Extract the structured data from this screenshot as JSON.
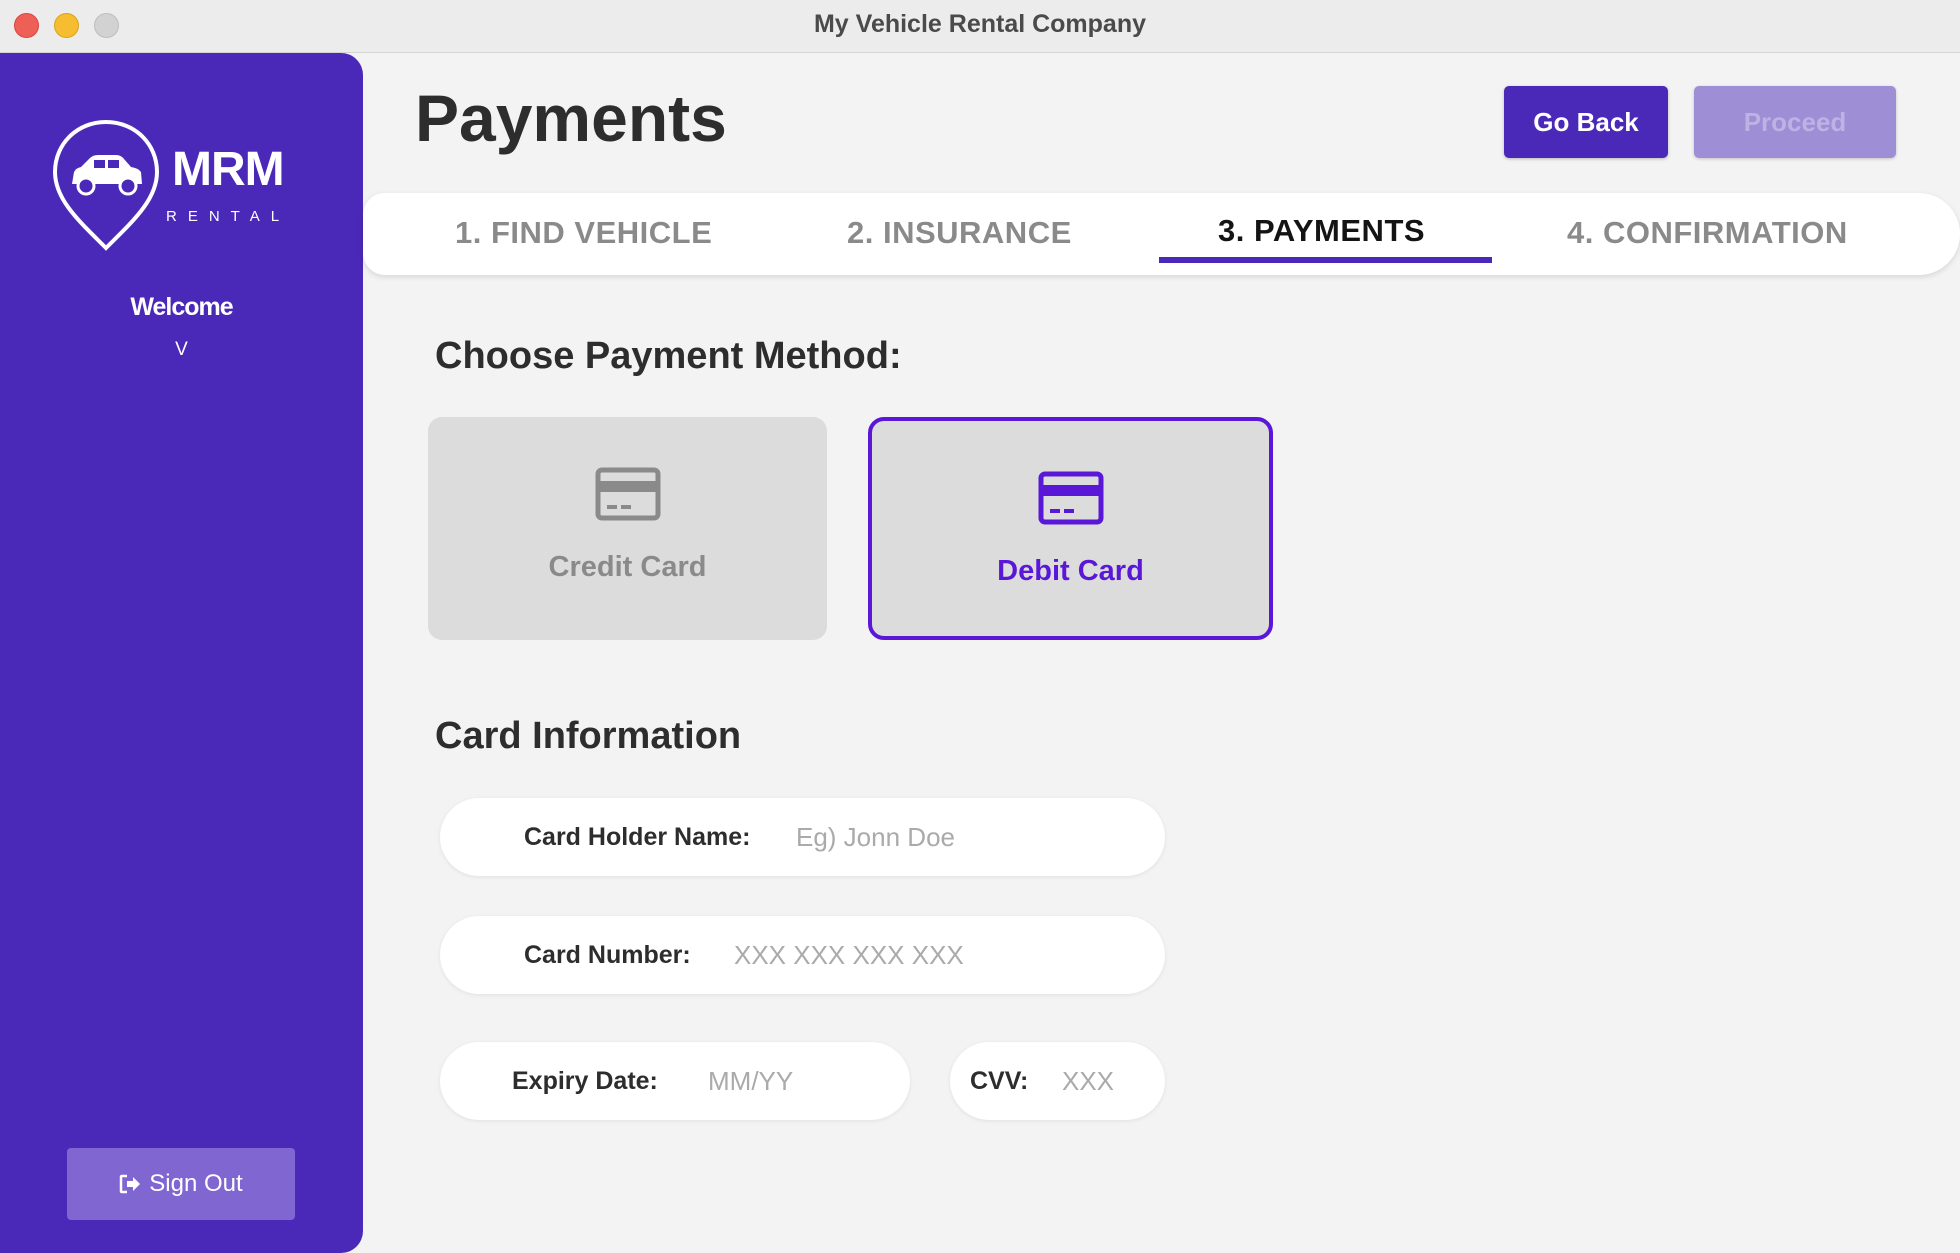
{
  "window": {
    "title": "My Vehicle Rental Company"
  },
  "sidebar": {
    "logo_name": "MRM",
    "logo_tagline": "RENTAL",
    "welcome": "Welcome",
    "username": "V",
    "sign_out_label": "Sign Out"
  },
  "header": {
    "title": "Payments",
    "back_label": "Go Back",
    "proceed_label": "Proceed"
  },
  "steps": [
    {
      "label": "1. FIND VEHICLE",
      "active": false
    },
    {
      "label": "2. INSURANCE",
      "active": false
    },
    {
      "label": "3. PAYMENTS",
      "active": true
    },
    {
      "label": "4. CONFIRMATION",
      "active": false
    }
  ],
  "payment": {
    "heading": "Choose Payment Method:",
    "options": [
      {
        "label": "Credit Card",
        "icon": "credit-card-icon",
        "selected": false
      },
      {
        "label": "Debit Card",
        "icon": "debit-card-icon",
        "selected": true
      }
    ]
  },
  "card_info": {
    "heading": "Card Information",
    "holder_label": "Card Holder Name:",
    "holder_placeholder": "Eg) Jonn Doe",
    "holder_value": "",
    "number_label": "Card Number:",
    "number_placeholder": "XXX XXX XXX XXX",
    "number_value": "",
    "expiry_label": "Expiry Date:",
    "expiry_placeholder": "MM/YY",
    "expiry_value": "",
    "cvv_label": "CVV:",
    "cvv_placeholder": "XXX",
    "cvv_value": ""
  },
  "colors": {
    "brand": "#4a29b8",
    "selected_accent": "#5a17d8",
    "background": "#f3f3f4",
    "disabled_button": "#9d8ed6"
  }
}
